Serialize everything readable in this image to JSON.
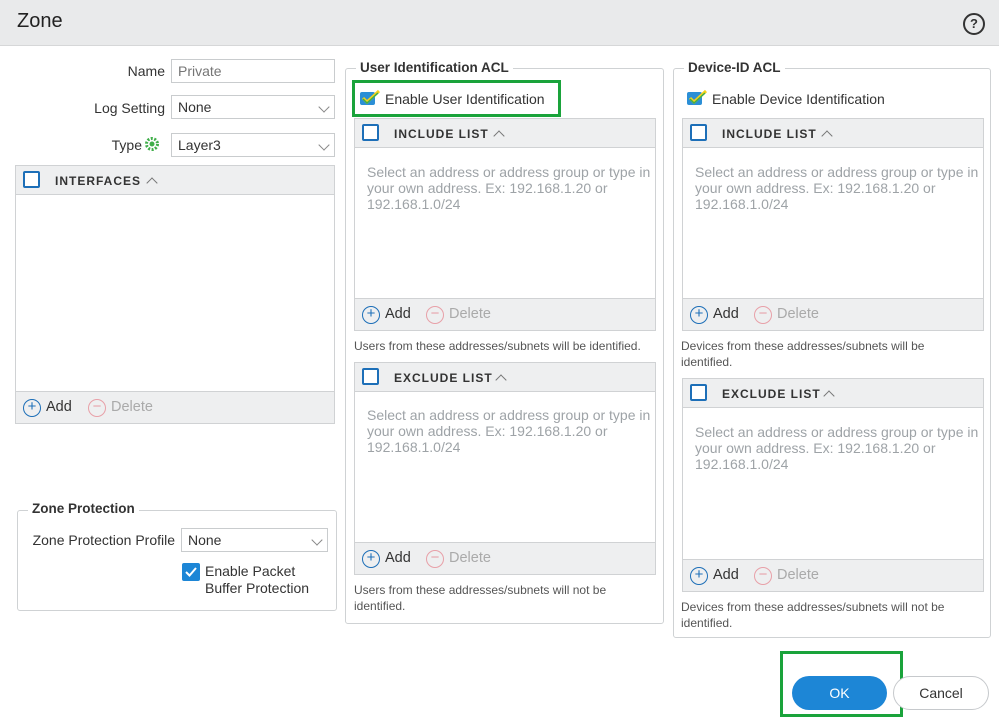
{
  "dialog": {
    "title": "Zone",
    "help_glyph": "?"
  },
  "left": {
    "name": {
      "label": "Name",
      "placeholder": "Private"
    },
    "log_setting": {
      "label": "Log Setting",
      "value": "None"
    },
    "type": {
      "label": "Type",
      "value": "Layer3"
    },
    "interfaces": {
      "header": "INTERFACES",
      "add_label": "Add",
      "delete_label": "Delete"
    },
    "zone_protection": {
      "legend": "Zone Protection",
      "profile_label": "Zone Protection Profile",
      "profile_value": "None",
      "packet_buffer_line1": "Enable Packet",
      "packet_buffer_line2": "Buffer Protection",
      "packet_buffer_checked": true
    }
  },
  "user_acl": {
    "legend": "User Identification ACL",
    "enable_label": "Enable User Identification",
    "include": {
      "header": "INCLUDE LIST",
      "hint_lines": [
        "Select an address or address group or type in",
        "your own address. Ex: 192.168.1.20 or",
        "192.168.1.0/24"
      ],
      "add_label": "Add",
      "delete_label": "Delete",
      "note": "Users from these addresses/subnets will be identified."
    },
    "exclude": {
      "header": "EXCLUDE LIST",
      "hint_lines": [
        "Select an address or address group or type in",
        "your own address. Ex: 192.168.1.20 or",
        "192.168.1.0/24"
      ],
      "add_label": "Add",
      "delete_label": "Delete",
      "note_lines": [
        "Users from these addresses/subnets will not be",
        "identified."
      ]
    }
  },
  "device_acl": {
    "legend": "Device-ID ACL",
    "enable_label": "Enable Device Identification",
    "include": {
      "header": "INCLUDE LIST",
      "hint_lines": [
        "Select an address or address group or type in",
        "your own address. Ex: 192.168.1.20 or",
        "192.168.1.0/24"
      ],
      "add_label": "Add",
      "delete_label": "Delete",
      "note_lines": [
        "Devices from these addresses/subnets will be",
        "identified."
      ]
    },
    "exclude": {
      "header": "EXCLUDE LIST",
      "hint_lines": [
        "Select an address or address group or type in",
        "your own address. Ex: 192.168.1.20 or",
        "192.168.1.0/24"
      ],
      "add_label": "Add",
      "delete_label": "Delete",
      "note_lines": [
        "Devices from these addresses/subnets will not be",
        "identified."
      ]
    }
  },
  "footer": {
    "ok_label": "OK",
    "cancel_label": "Cancel"
  },
  "colors": {
    "accent": "#1d86d6",
    "highlight": "#1aa33b",
    "checkbox": "#1d6fb8"
  }
}
